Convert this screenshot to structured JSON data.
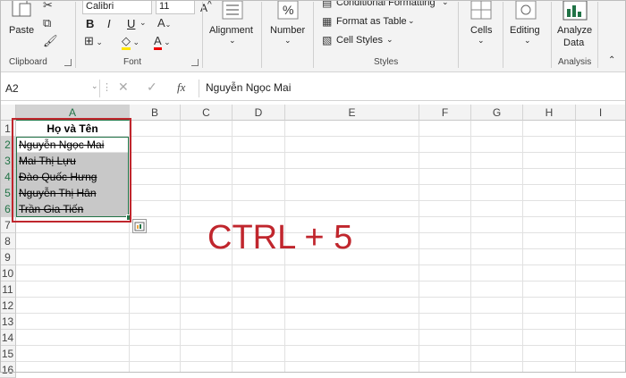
{
  "ribbon": {
    "paste_label": "Paste",
    "font_name": "Calibri",
    "font_size": "11",
    "bold": "B",
    "italic": "I",
    "underline": "U",
    "clipboard_label": "Clipboard",
    "font_label": "Font",
    "alignment_label": "Alignment",
    "number_label": "Number",
    "conditional_label": "Conditional Formatting",
    "format_table_label": "Format as Table",
    "cell_styles_label": "Cell Styles",
    "styles_label": "Styles",
    "cells_label": "Cells",
    "editing_label": "Editing",
    "analyze_label_1": "Analyze",
    "analyze_label_2": "Data",
    "analysis_label": "Analysis"
  },
  "formula": {
    "name_box": "A2",
    "fx": "fx",
    "content": "Nguyễn Ngọc Mai"
  },
  "columns": [
    "A",
    "B",
    "C",
    "D",
    "E",
    "F",
    "G",
    "H",
    "I"
  ],
  "rows": [
    "1",
    "2",
    "3",
    "4",
    "5",
    "6",
    "7",
    "8",
    "9",
    "10",
    "11",
    "12",
    "13",
    "14",
    "15",
    "16"
  ],
  "header_cell": "Họ và Tên",
  "names": [
    "Nguyễn Ngọc Mai",
    "Mai Thị Lựu",
    "Đào Quốc Hưng",
    "Nguyễn Thị Hân",
    "Trần Gia Tiến"
  ],
  "overlay_text": "CTRL + 5",
  "colors": {
    "accent_red": "#c0262d",
    "selection_fill": "#c8c8c8",
    "excel_green": "#217346"
  }
}
